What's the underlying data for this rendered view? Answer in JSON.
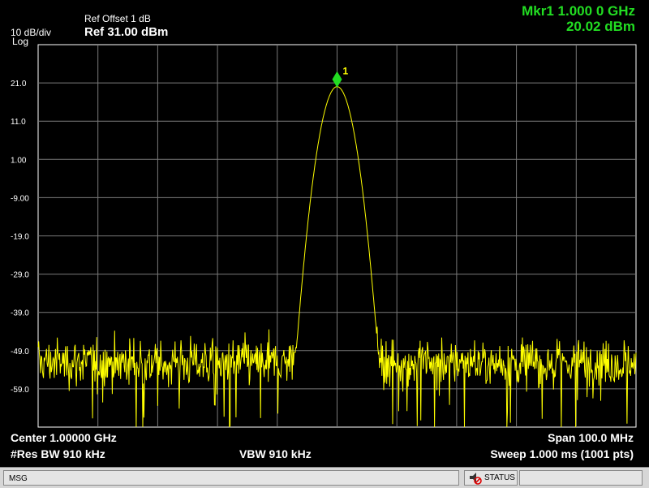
{
  "header": {
    "ref_offset": "Ref Offset 1 dB",
    "scale": "10 dB/div",
    "ref_level": "Ref 31.00 dBm",
    "scale_type": "Log"
  },
  "marker": {
    "label": "Mkr1 1.000 0 GHz",
    "value": "20.02 dBm",
    "number": "1",
    "freq_ghz": 1.0,
    "level_dbm": 20.02,
    "color": "#22dd22"
  },
  "axis": {
    "y_ticks": [
      "21.0",
      "11.0",
      "1.00",
      "-9.00",
      "-19.0",
      "-29.0",
      "-39.0",
      "-49.0",
      "-59.0"
    ]
  },
  "footer": {
    "center": "Center 1.00000 GHz",
    "res_bw": "#Res BW 910 kHz",
    "vbw": "VBW 910 kHz",
    "span": "Span 100.0 MHz",
    "sweep": "Sweep  1.000 ms (1001 pts)"
  },
  "status_bar": {
    "msg": "MSG",
    "status": "STATUS"
  },
  "chart_data": {
    "type": "line",
    "x_center_ghz": 1.0,
    "span_mhz": 100.0,
    "xlim_ghz": [
      0.95,
      1.05
    ],
    "ylim_dbm": [
      -69,
      31
    ],
    "points": 1001,
    "grid": true,
    "noise_floor_dbm": -52,
    "peak": {
      "x_ghz": 1.0,
      "y_dbm": 20.02
    },
    "trace_color": "#ffff00"
  }
}
